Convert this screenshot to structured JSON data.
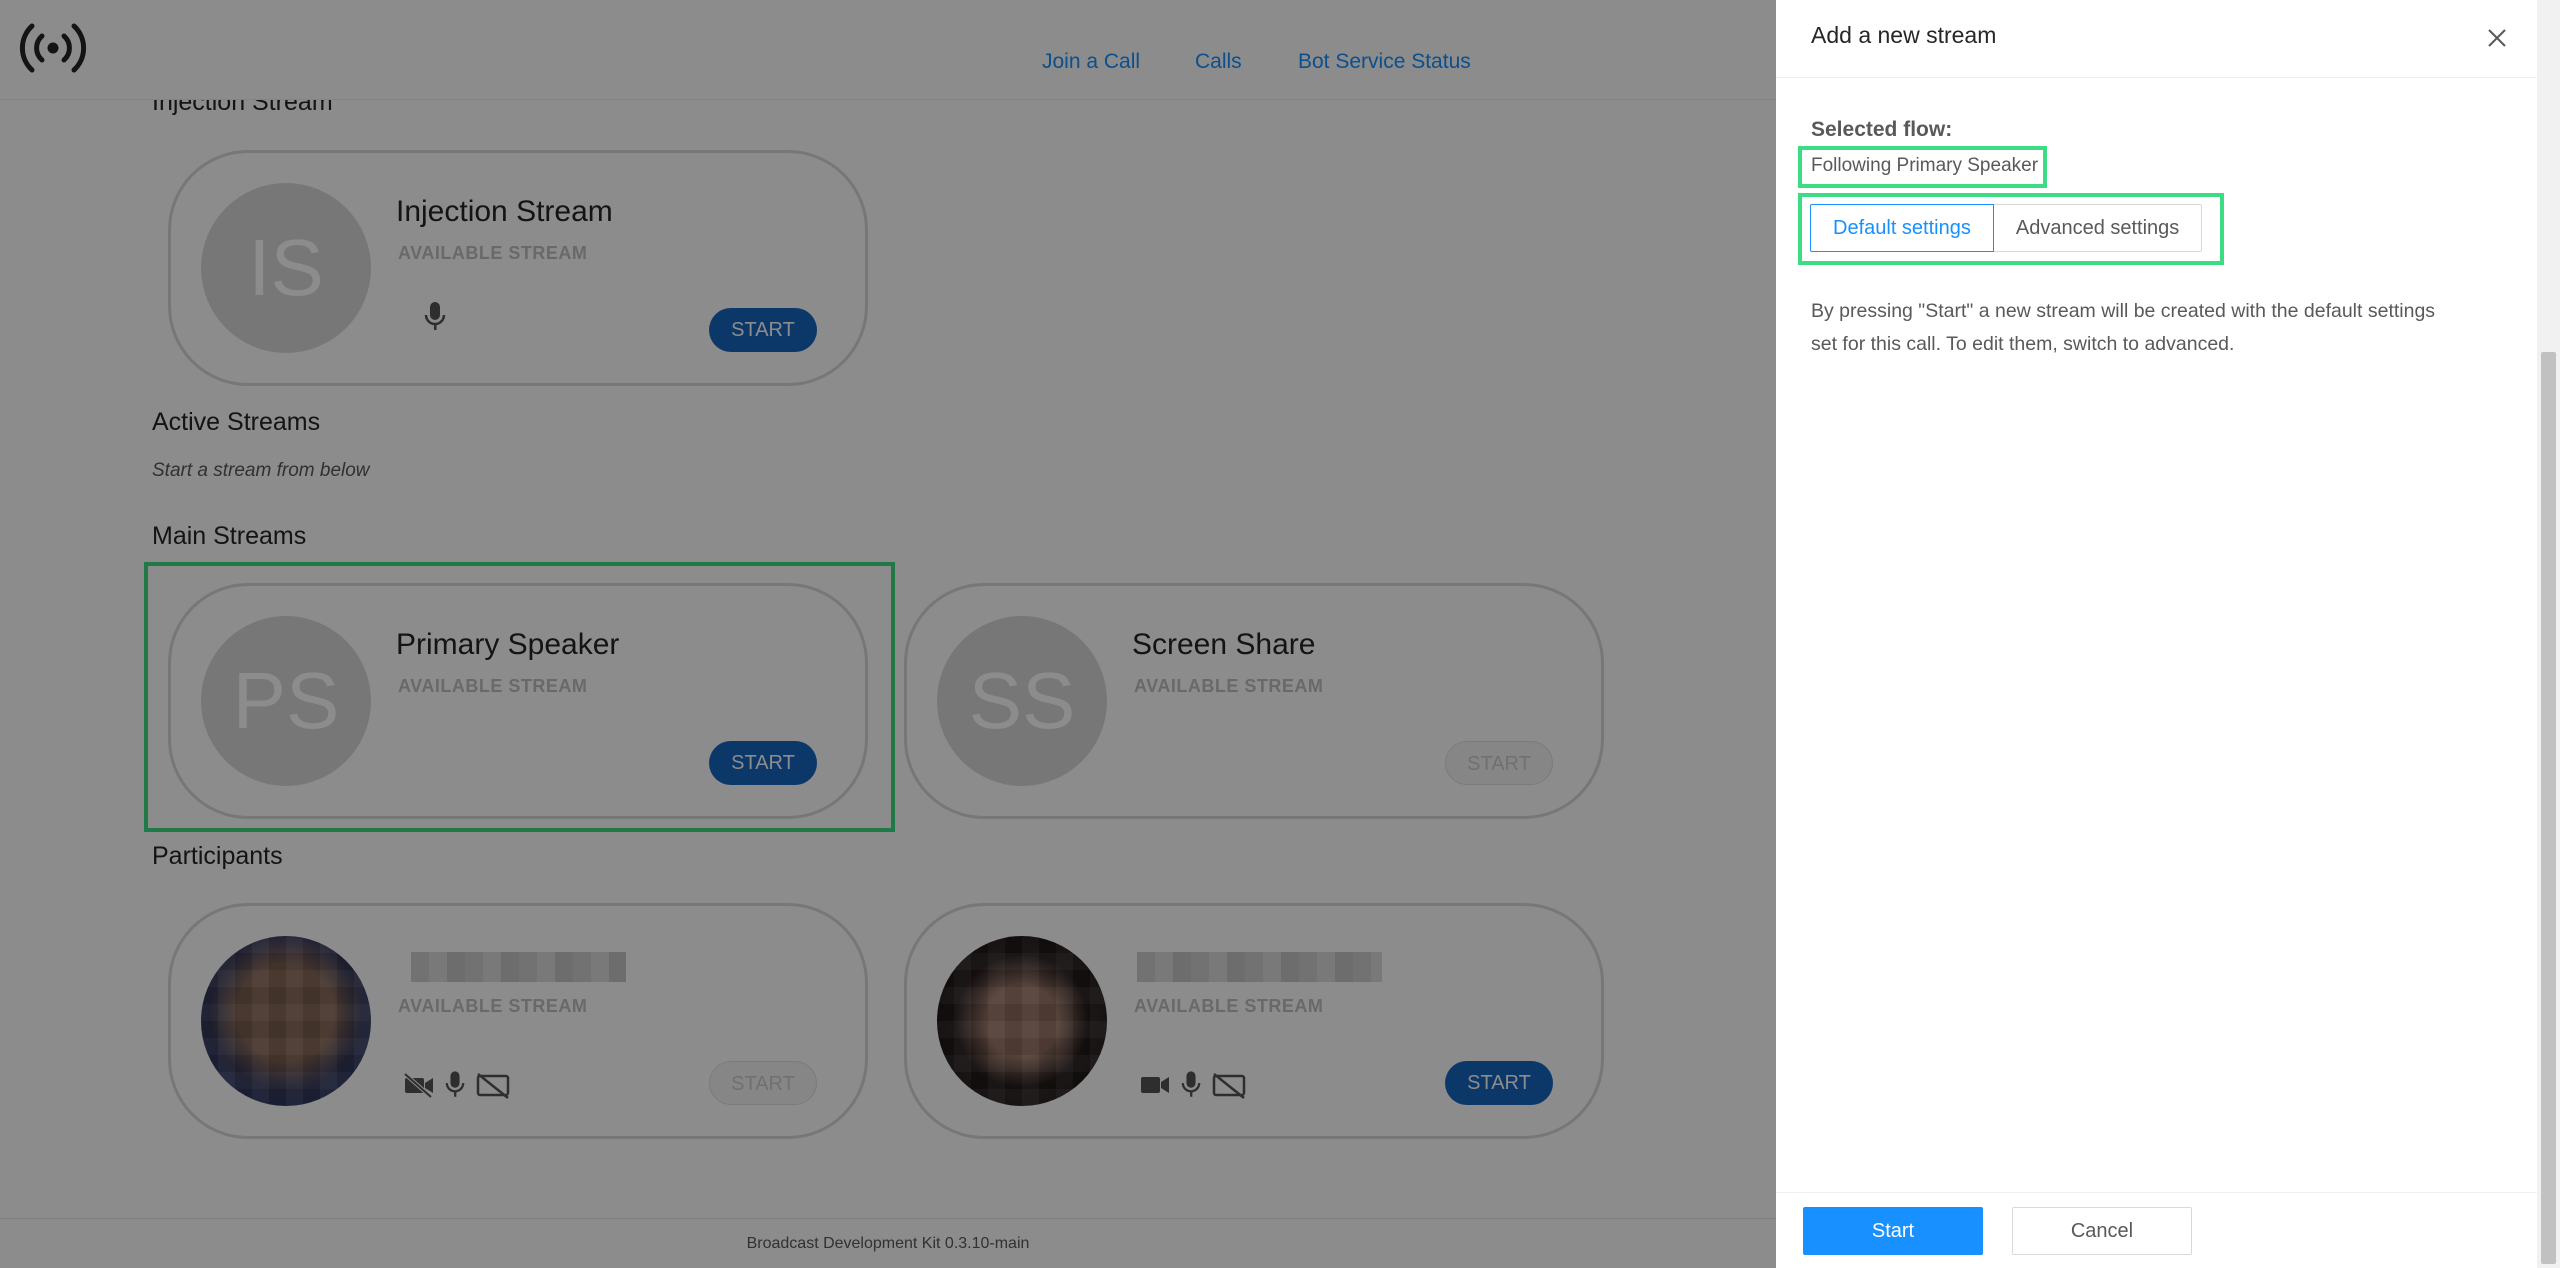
{
  "nav": {
    "join": "Join a Call",
    "calls": "Calls",
    "status": "Bot Service Status"
  },
  "sections": {
    "injection": "Injection Stream",
    "active": "Active Streams",
    "active_hint": "Start a stream from below",
    "main": "Main Streams",
    "participants": "Participants"
  },
  "cards": {
    "injection": {
      "initials": "IS",
      "title": "Injection Stream",
      "subtitle": "AVAILABLE STREAM",
      "start": "START"
    },
    "primary": {
      "initials": "PS",
      "title": "Primary Speaker",
      "subtitle": "AVAILABLE STREAM",
      "start": "START"
    },
    "screen": {
      "initials": "SS",
      "title": "Screen Share",
      "subtitle": "AVAILABLE STREAM",
      "start": "START"
    },
    "participant1": {
      "subtitle": "AVAILABLE STREAM",
      "start": "START"
    },
    "participant2": {
      "subtitle": "AVAILABLE STREAM",
      "start": "START"
    }
  },
  "footer": "Broadcast Development Kit 0.3.10-main",
  "drawer": {
    "title": "Add a new stream",
    "selected_flow_label": "Selected flow:",
    "selected_flow_value": "Following Primary Speaker",
    "tab_default": "Default settings",
    "tab_advanced": "Advanced settings",
    "description": "By pressing \"Start\" a new stream will be created with the default settings set for this call. To edit them, switch to advanced.",
    "start": "Start",
    "cancel": "Cancel"
  },
  "colors": {
    "accent": "#1890ff",
    "start_pill": "#1565c0",
    "highlight": "#3ddc84"
  }
}
